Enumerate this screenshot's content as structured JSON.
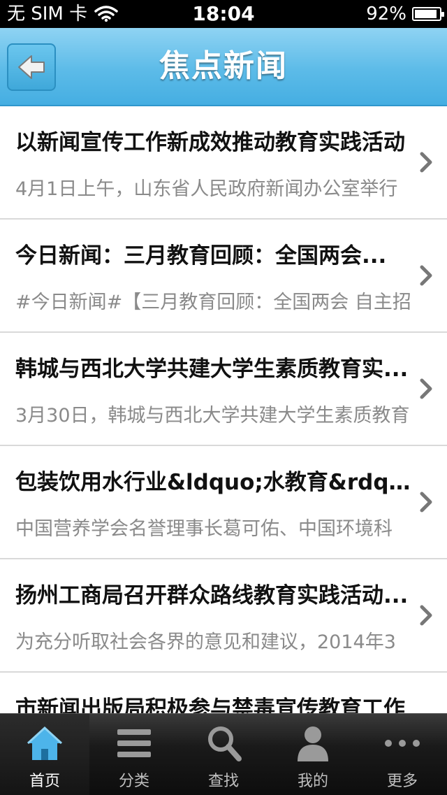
{
  "status_bar": {
    "carrier": "无 SIM 卡",
    "time": "18:04",
    "battery": "92%",
    "battery_level": 0.92
  },
  "nav": {
    "title": "焦点新闻",
    "back_icon": "arrow-left-icon"
  },
  "news": [
    {
      "title": "以新闻宣传工作新成效推动教育实践活动",
      "summary": "4月1日上午，山东省人民政府新闻办公室举行"
    },
    {
      "title": "今日新闻：三月教育回顾：全国两会...",
      "summary": "#今日新闻#【三月教育回顾：全国两会 自主招"
    },
    {
      "title": "韩城与西北大学共建大学生素质教育实...",
      "summary": "3月30日，韩城与西北大学共建大学生素质教育"
    },
    {
      "title": "包装饮用水行业&ldquo;水教育&rdqu...",
      "summary": "中国营养学会名誉理事长葛可佑、中国环境科"
    },
    {
      "title": "扬州工商局召开群众路线教育实践活动...",
      "summary": "为充分听取社会各界的意见和建议，2014年3"
    },
    {
      "title": "市新闻出版局积极参与禁毒宣传教育工作",
      "summary": ""
    }
  ],
  "tabs": [
    {
      "label": "首页",
      "icon": "home-icon",
      "active": true
    },
    {
      "label": "分类",
      "icon": "list-icon",
      "active": false
    },
    {
      "label": "查找",
      "icon": "search-icon",
      "active": false
    },
    {
      "label": "我的",
      "icon": "user-icon",
      "active": false
    },
    {
      "label": "更多",
      "icon": "more-icon",
      "active": false
    }
  ],
  "colors": {
    "nav_blue": "#5cbbe8",
    "tab_active_icon": "#4db4ea"
  }
}
